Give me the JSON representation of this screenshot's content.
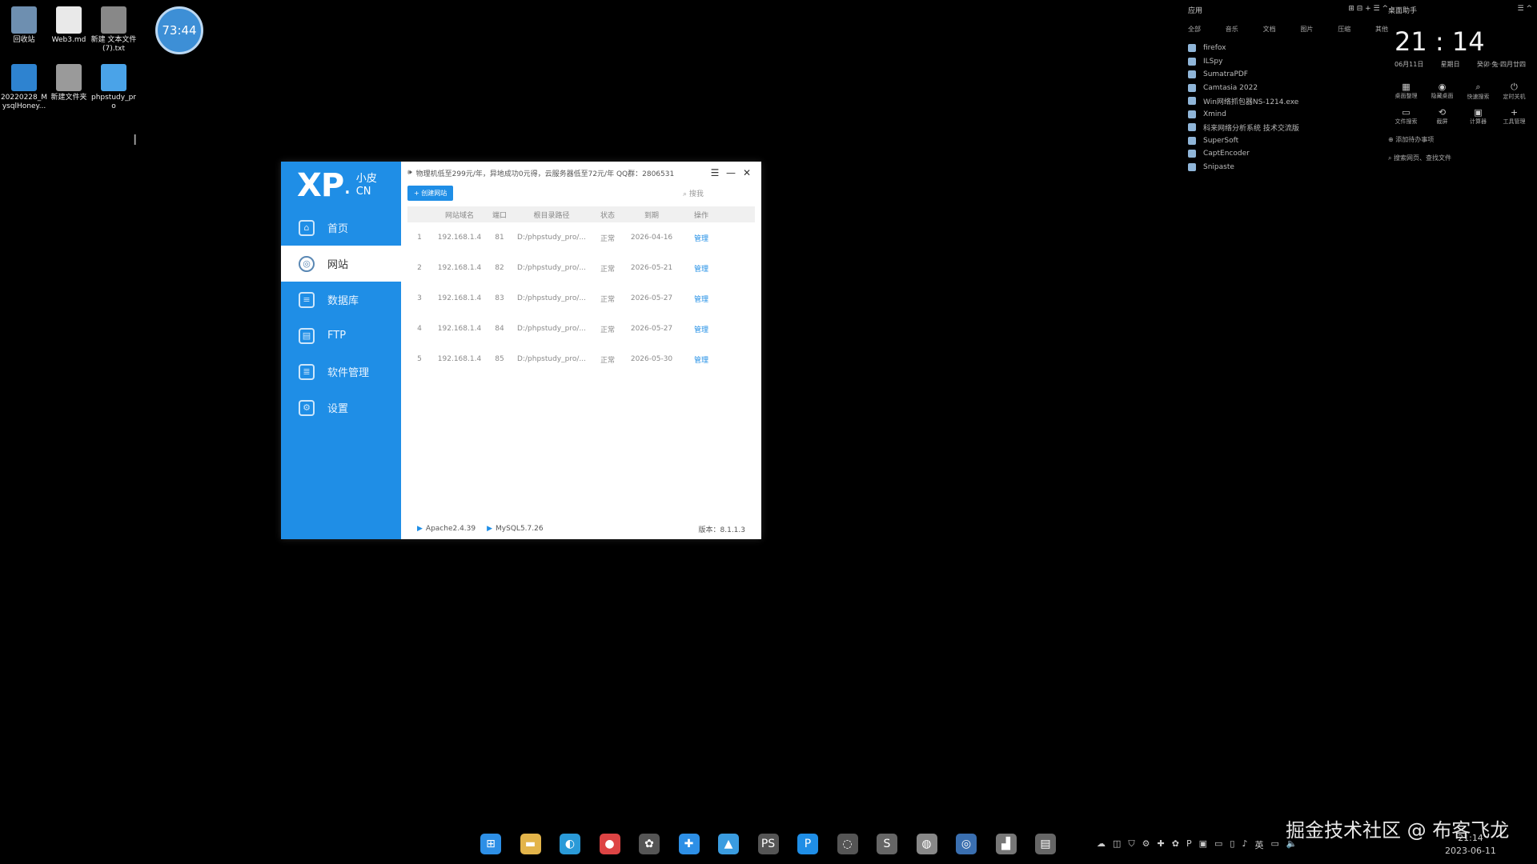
{
  "desktop": {
    "icons": [
      {
        "label": "回收站",
        "color": "#6e8fb0"
      },
      {
        "label": "Web3.md",
        "color": "#e9e9e9"
      },
      {
        "label": "新建 文本文件 (7).txt",
        "color": "#888888"
      },
      {
        "label": "20220228_MysqlHoney...",
        "color": "#2e83d0"
      },
      {
        "label": "新建文件夹",
        "color": "#9a9a9a"
      },
      {
        "label": "phpstudy_pro",
        "color": "#4aa3e8"
      }
    ],
    "clock_badge": "73:44",
    "cursor": "I"
  },
  "app": {
    "logo": {
      "main": "XP",
      "dot": ".",
      "sub_top": "小皮",
      "sub_bottom": "CN"
    },
    "nav": [
      {
        "label": "首页",
        "icon": "⌂"
      },
      {
        "label": "网站",
        "icon": "◎"
      },
      {
        "label": "数据库",
        "icon": "≡"
      },
      {
        "label": "FTP",
        "icon": "▤"
      },
      {
        "label": "软件管理",
        "icon": "≣"
      },
      {
        "label": "设置",
        "icon": "⚙"
      }
    ],
    "notice": "物理机低至299元/年，异地成功0元得，云服务器低至72元/年 QQ群：2806531",
    "window_buttons": {
      "menu": "☰",
      "min": "—",
      "close": "✕"
    },
    "add_button": "+ 创建网站",
    "search_placeholder": "搜我",
    "columns": [
      "",
      "网站域名",
      "端口",
      "根目录路径",
      "状态",
      "到期",
      "操作"
    ],
    "rows": [
      {
        "no": "1",
        "domain": "192.168.1.4",
        "port": "81",
        "path": "D:/phpstudy_pro/...",
        "status": "正常",
        "date": "2026-04-16",
        "action": "管理"
      },
      {
        "no": "2",
        "domain": "192.168.1.4",
        "port": "82",
        "path": "D:/phpstudy_pro/...",
        "status": "正常",
        "date": "2026-05-21",
        "action": "管理"
      },
      {
        "no": "3",
        "domain": "192.168.1.4",
        "port": "83",
        "path": "D:/phpstudy_pro/...",
        "status": "正常",
        "date": "2026-05-27",
        "action": "管理"
      },
      {
        "no": "4",
        "domain": "192.168.1.4",
        "port": "84",
        "path": "D:/phpstudy_pro/...",
        "status": "正常",
        "date": "2026-05-27",
        "action": "管理"
      },
      {
        "no": "5",
        "domain": "192.168.1.4",
        "port": "85",
        "path": "D:/phpstudy_pro/...",
        "status": "正常",
        "date": "2026-05-30",
        "action": "管理"
      }
    ],
    "status": {
      "apache": "Apache2.4.39",
      "mysql": "MySQL5.7.26",
      "version": "版本：8.1.1.3"
    }
  },
  "applist": {
    "title": "应用",
    "tabs": [
      "全部",
      "音乐",
      "文档",
      "图片",
      "压缩",
      "其他"
    ],
    "items": [
      "firefox",
      "ILSpy",
      "SumatraPDF",
      "Camtasia 2022",
      "Win网络抓包器NS-1214.exe",
      "Xmind",
      "科来网络分析系统 技术交流版",
      "SuperSoft",
      "CaptEncoder",
      "Snipaste"
    ]
  },
  "widget": {
    "title": "桌面助手",
    "time": "21 : 14",
    "date": "06月11日",
    "weekday": "星期日",
    "lunar": "癸卯·兔·四月廿四",
    "quick": [
      {
        "icon": "▦",
        "label": "桌面整理"
      },
      {
        "icon": "◉",
        "label": "隐藏桌面"
      },
      {
        "icon": "⌕",
        "label": "快速搜索"
      },
      {
        "icon": "⏻",
        "label": "定时关机"
      },
      {
        "icon": "▭",
        "label": "文件搜索"
      },
      {
        "icon": "⟲",
        "label": "截屏"
      },
      {
        "icon": "▣",
        "label": "计算器"
      },
      {
        "icon": "+",
        "label": "工具管理"
      }
    ],
    "add_note": "添加待办事项",
    "search_hint": "搜索网页、查找文件"
  },
  "taskbar": {
    "apps": [
      {
        "name": "windows-start",
        "glyph": "⊞",
        "color": "#2d8fe6"
      },
      {
        "name": "file-explorer",
        "glyph": "▬",
        "color": "#e3b44a"
      },
      {
        "name": "edge",
        "glyph": "◐",
        "color": "#2a9ad8"
      },
      {
        "name": "chrome",
        "glyph": "●",
        "color": "#d44"
      },
      {
        "name": "app-5",
        "glyph": "✿",
        "color": "#555"
      },
      {
        "name": "app-6",
        "glyph": "✚",
        "color": "#2d8fe6"
      },
      {
        "name": "app-7",
        "glyph": "▲",
        "color": "#3a9ce0"
      },
      {
        "name": "app-8",
        "glyph": "PS",
        "color": "#555"
      },
      {
        "name": "phpstudy",
        "glyph": "P",
        "color": "#1f8ee6"
      },
      {
        "name": "app-10",
        "glyph": "◌",
        "color": "#555"
      },
      {
        "name": "app-11",
        "glyph": "S",
        "color": "#666"
      },
      {
        "name": "app-12",
        "glyph": "◍",
        "color": "#888"
      },
      {
        "name": "app-13",
        "glyph": "◎",
        "color": "#3a6fb0"
      },
      {
        "name": "app-14",
        "glyph": "▟",
        "color": "#777"
      },
      {
        "name": "app-15",
        "glyph": "▤",
        "color": "#666"
      }
    ],
    "tray": [
      "☁",
      "◫",
      "⛉",
      "⚙",
      "✚",
      "✿",
      "P",
      "▣",
      "▭",
      "▯",
      "♪",
      "英",
      "▭",
      "🔈"
    ],
    "time": "21:14",
    "date": "2023-06-11"
  },
  "watermark": "掘金技术社区 @ 布客飞龙"
}
